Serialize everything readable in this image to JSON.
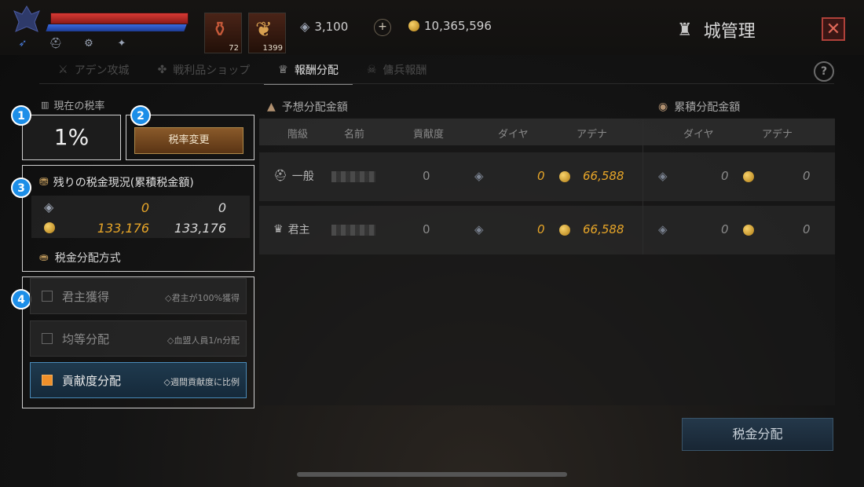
{
  "header": {
    "items": [
      {
        "count": "72"
      },
      {
        "count": "1399"
      }
    ],
    "diamond_amount": "3,100",
    "adena_amount": "10,365,596",
    "plus_label": "+",
    "title": "城管理",
    "close_label": "✕"
  },
  "tabs": [
    {
      "label": "アデン攻城",
      "icon": "swords-icon"
    },
    {
      "label": "戦利品ショップ",
      "icon": "shop-icon"
    },
    {
      "label": "報酬分配",
      "icon": "reward-icon",
      "active": true
    },
    {
      "label": "傭兵報酬",
      "icon": "mercenary-icon"
    }
  ],
  "help_label": "?",
  "left": {
    "current_rate_label": "現在の税率",
    "current_rate_value": "1%",
    "change_rate_button": "税率変更",
    "remaining_title": "残りの税金現況(累積税金額)",
    "remaining": {
      "diamond": [
        "0",
        "0"
      ],
      "adena": [
        "133,176",
        "133,176"
      ]
    },
    "method_label": "税金分配方式",
    "options": [
      {
        "name": "君主獲得",
        "desc": "◇君主が100%獲得",
        "selected": false
      },
      {
        "name": "均等分配",
        "desc": "◇血盟人員1/n分配",
        "selected": false
      },
      {
        "name": "貢献度分配",
        "desc": "◇週間貢献度に比例",
        "selected": true
      }
    ],
    "steps": [
      "1",
      "2",
      "3",
      "4"
    ]
  },
  "right": {
    "expected_title": "予想分配金額",
    "cumulative_title": "累積分配金額",
    "columns": [
      "階級",
      "名前",
      "貢献度",
      "ダイヤ",
      "アデナ",
      "ダイヤ",
      "アデナ"
    ],
    "rows": [
      {
        "rank": "一般",
        "contribution": "0",
        "exp_diamond": "0",
        "exp_adena": "66,588",
        "cum_diamond": "0",
        "cum_adena": "0"
      },
      {
        "rank": "君主",
        "contribution": "0",
        "exp_diamond": "0",
        "exp_adena": "66,588",
        "cum_diamond": "0",
        "cum_adena": "0"
      }
    ],
    "distribute_button": "税金分配"
  },
  "colors": {
    "accent_orange": "#e8a628",
    "step_blue": "#1c8ee8",
    "close_red": "#b0413a"
  }
}
